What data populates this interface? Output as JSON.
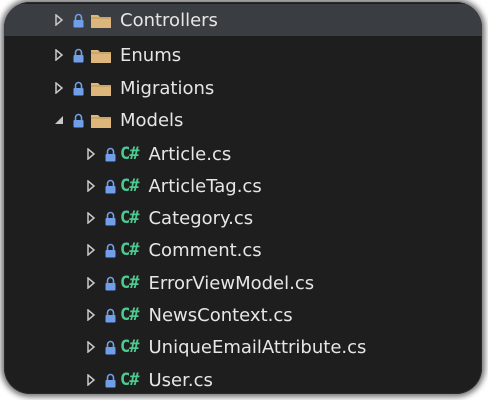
{
  "colors": {
    "background": "#1e1e1e",
    "selected_row": "#3a3d41",
    "text": "#e6e6e6",
    "lock": "#6f9fe8",
    "folder": "#dcb67a",
    "csharp": "#4ec98f",
    "chevron": "#c8c8c8"
  },
  "icons": {
    "expand_collapsed": "chevron-right-icon",
    "expand_open": "chevron-down-icon",
    "lock": "lock-icon",
    "folder": "folder-icon",
    "csharp_file": "csharp-file-icon"
  },
  "tree": {
    "folders": {
      "controllers": "Controllers",
      "enums": "Enums",
      "migrations": "Migrations",
      "models": "Models"
    },
    "csharp_badge": "C#",
    "model_files": {
      "article": "Article.cs",
      "article_tag": "ArticleTag.cs",
      "category": "Category.cs",
      "comment": "Comment.cs",
      "error_view_model": "ErrorViewModel.cs",
      "news_context": "NewsContext.cs",
      "unique_email_attribute": "UniqueEmailAttribute.cs",
      "user": "User.cs"
    }
  }
}
